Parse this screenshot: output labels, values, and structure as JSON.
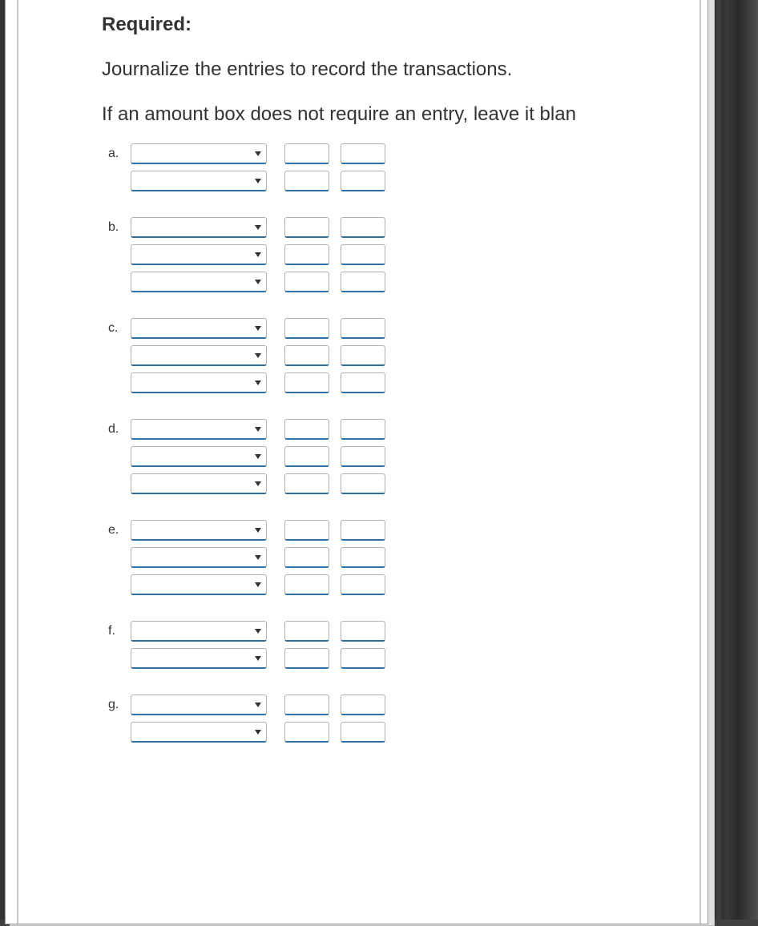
{
  "heading": "Required:",
  "instruction": "Journalize the entries to record the transactions.",
  "note": "If an amount box does not require an entry, leave it blan",
  "entries": [
    {
      "label": "a.",
      "rows": 2
    },
    {
      "label": "b.",
      "rows": 3
    },
    {
      "label": "c.",
      "rows": 3
    },
    {
      "label": "d.",
      "rows": 3
    },
    {
      "label": "e.",
      "rows": 3
    },
    {
      "label": "f.",
      "rows": 2
    },
    {
      "label": "g.",
      "rows": 2
    }
  ]
}
